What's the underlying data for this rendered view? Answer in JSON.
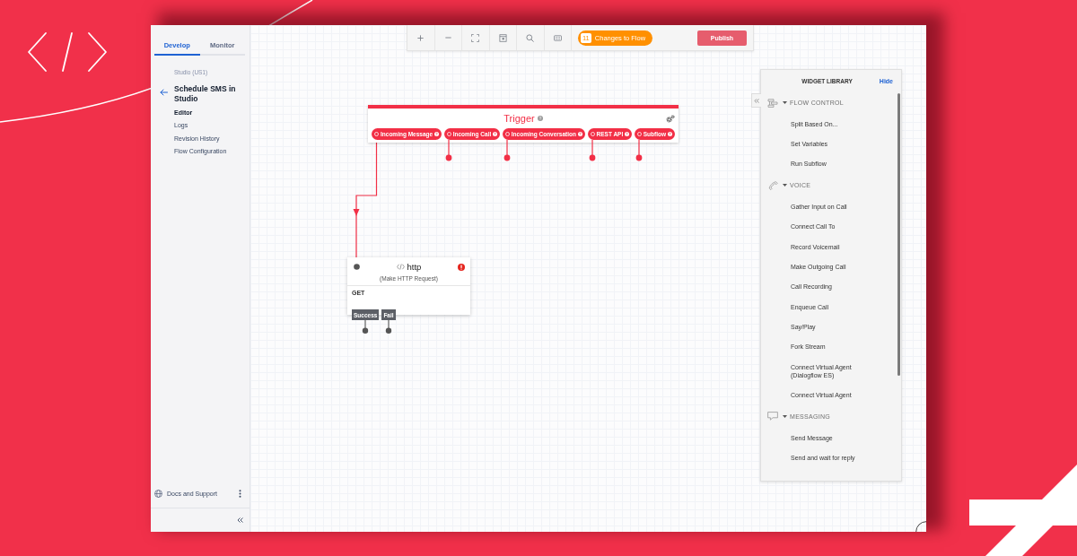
{
  "sidebar": {
    "tabs": [
      {
        "label": "Develop",
        "selected": true
      },
      {
        "label": "Monitor",
        "selected": false
      }
    ],
    "breadcrumb": "Studio (US1)",
    "flow_title": "Schedule SMS in Studio",
    "nav": [
      {
        "label": "Editor",
        "selected": true
      },
      {
        "label": "Logs",
        "selected": false
      },
      {
        "label": "Revision History",
        "selected": false
      },
      {
        "label": "Flow Configuration",
        "selected": false
      }
    ],
    "footer_link": "Docs and Support"
  },
  "toolbar": {
    "changes_count": "11",
    "changes_label": "Changes to Flow",
    "publish": {
      "label": "Publish",
      "disabled": true
    }
  },
  "trigger": {
    "title": "Trigger",
    "ports": [
      {
        "label": "Incoming Message",
        "connected": true
      },
      {
        "label": "Incoming Call",
        "connected": false
      },
      {
        "label": "Incoming Conversation",
        "connected": false
      },
      {
        "label": "REST API",
        "connected": false
      },
      {
        "label": "Subflow",
        "connected": false
      }
    ]
  },
  "http_widget": {
    "title": "http",
    "subtitle": "(Make HTTP Request)",
    "method": "GET",
    "error": true,
    "transitions": [
      {
        "label": "Success"
      },
      {
        "label": "Fail"
      }
    ]
  },
  "widget_library": {
    "title": "WIDGET LIBRARY",
    "hide_label": "Hide",
    "sections": [
      {
        "kind": "flow-control",
        "title": "FLOW CONTROL",
        "expanded": true,
        "items": [
          "Split Based On...",
          "Set Variables",
          "Run Subflow"
        ]
      },
      {
        "kind": "voice",
        "title": "VOICE",
        "expanded": true,
        "items": [
          "Gather Input on Call",
          "Connect Call To",
          "Record Voicemail",
          "Make Outgoing Call",
          "Call Recording",
          "Enqueue Call",
          "Say/Play",
          "Fork Stream",
          "Connect Virtual Agent (Dialogflow ES)",
          "Connect Virtual Agent"
        ]
      },
      {
        "kind": "messaging",
        "title": "MESSAGING",
        "expanded": true,
        "items": [
          "Send Message",
          "Send and wait for reply"
        ]
      }
    ]
  }
}
